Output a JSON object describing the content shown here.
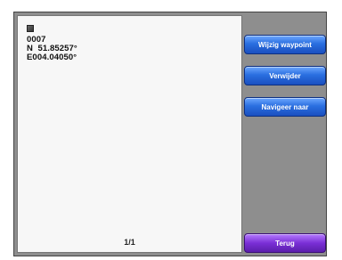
{
  "waypoint": {
    "icon": "waypoint-flag-icon",
    "name": "0007",
    "latitude": "N  51.85257°",
    "longitude": "E004.04050°"
  },
  "page_indicator": "1/1",
  "buttons": {
    "edit_waypoint": "Wijzig waypoint",
    "delete": "Verwijder",
    "navigate_to": "Navigeer naar",
    "back": "Terug"
  },
  "colors": {
    "action_button": "#2a6fe0",
    "back_button": "#7a2fd6",
    "frame": "#8e8e8e"
  }
}
